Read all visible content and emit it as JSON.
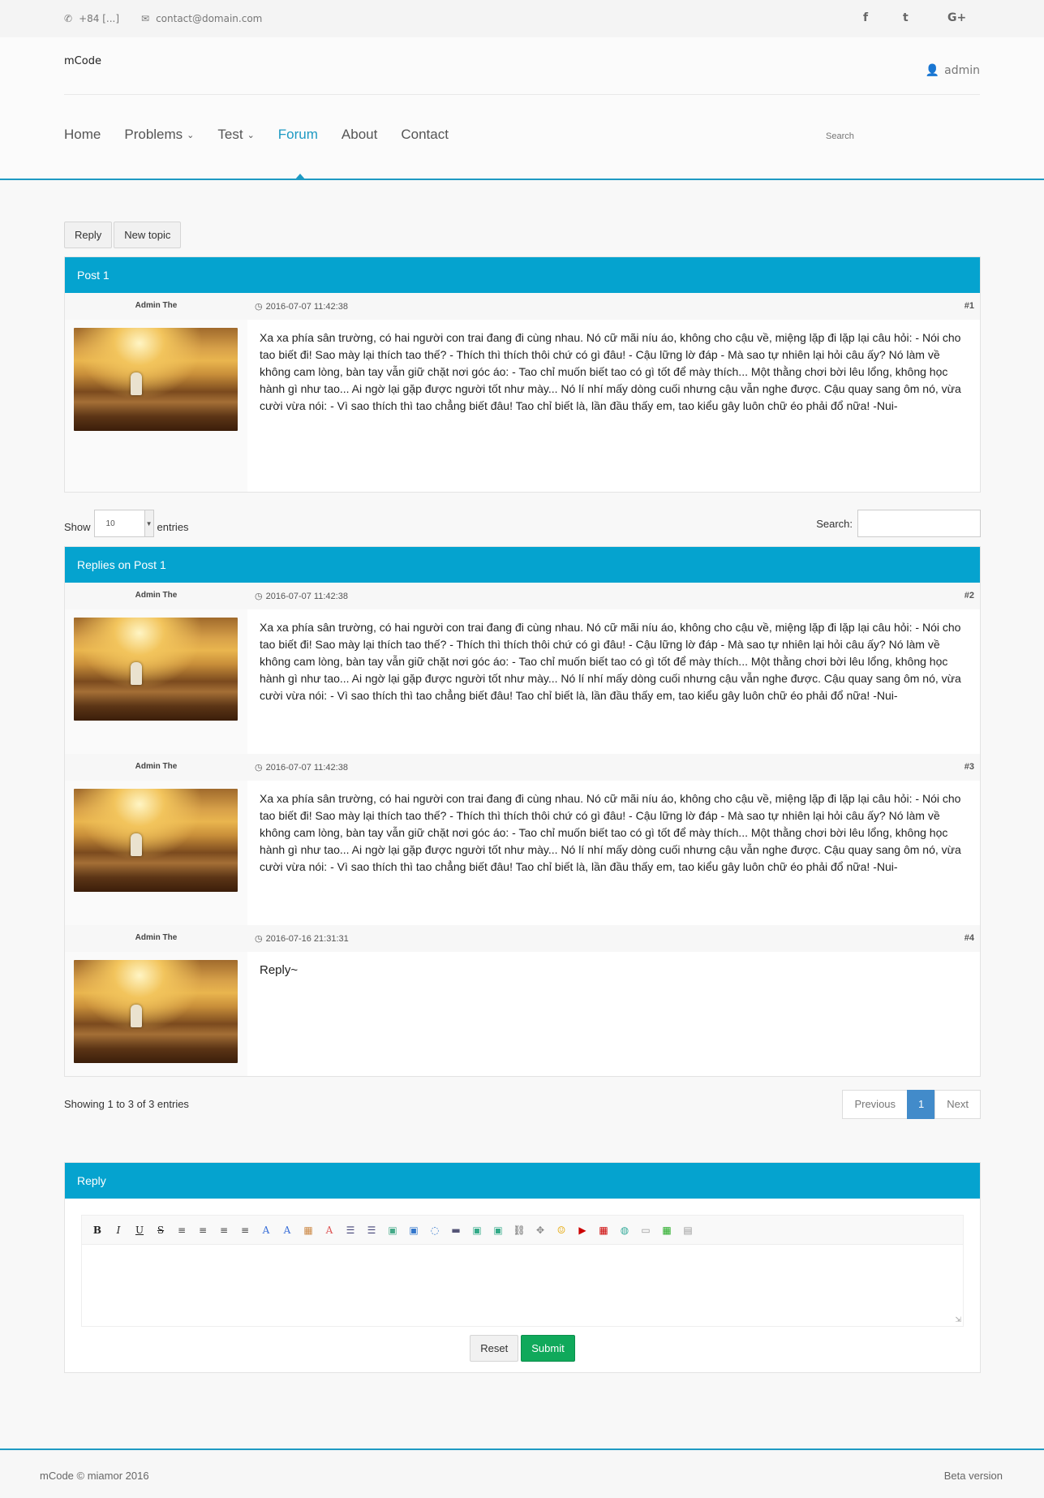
{
  "topbar": {
    "phone": "+84 [...]",
    "email": "contact@domain.com",
    "social": [
      "f",
      "t",
      "G+"
    ]
  },
  "header": {
    "logo": "mCode",
    "user": "admin",
    "nav": [
      "Home",
      "Problems",
      "Test",
      "Forum",
      "About",
      "Contact"
    ],
    "active_nav": "Forum",
    "search_placeholder": "Search"
  },
  "actions": {
    "reply": "Reply",
    "new_topic": "New topic"
  },
  "post": {
    "title": "Post 1",
    "author": "Admin The",
    "date": "2016-07-07 11:42:38",
    "number": "#1",
    "content": "Xa xa phía sân trường, có hai người con trai đang đi cùng nhau. Nó cữ mãi níu áo, không cho cậu về, miệng lặp đi lặp lại câu hỏi: - Nói cho tao biết đi! Sao mày lại thích tao thế? - Thích thì thích thôi chứ có gì đâu! - Cậu lững lờ đáp - Mà sao tự nhiên lại hỏi câu ấy? Nó làm về không cam lòng, bàn tay vẫn giữ chặt nơi góc áo: - Tao chỉ muốn biết tao có gì tốt để mày thích... Một thằng chơi bời lêu lổng, không học hành gì như tao... Ai ngờ lại gặp được người tốt như mày... Nó lí nhí mấy dòng cuối nhưng cậu vẫn nghe được. Cậu quay sang ôm nó, vừa cười vừa nói: - Vì sao thích thì tao chẳng biết đâu! Tao chỉ biết là, lần đầu thấy em, tao kiểu gây luôn chữ éo phải đổ nữa! -Nui-"
  },
  "datatable": {
    "show_label": "Show",
    "length": "10",
    "entries_label": "entries",
    "search_label": "Search:",
    "info": "Showing 1 to 3 of 3 entries",
    "prev": "Previous",
    "page": "1",
    "next": "Next"
  },
  "replies": {
    "title": "Replies on Post 1",
    "items": [
      {
        "author": "Admin The",
        "date": "2016-07-07 11:42:38",
        "number": "#2",
        "content": "Xa xa phía sân trường, có hai người con trai đang đi cùng nhau. Nó cữ mãi níu áo, không cho cậu về, miệng lặp đi lặp lại câu hỏi: - Nói cho tao biết đi! Sao mày lại thích tao thế? - Thích thì thích thôi chứ có gì đâu! - Cậu lững lờ đáp - Mà sao tự nhiên lại hỏi câu ấy? Nó làm về không cam lòng, bàn tay vẫn giữ chặt nơi góc áo: - Tao chỉ muốn biết tao có gì tốt để mày thích... Một thằng chơi bời lêu lổng, không học hành gì như tao... Ai ngờ lại gặp được người tốt như mày... Nó lí nhí mấy dòng cuối nhưng cậu vẫn nghe được. Cậu quay sang ôm nó, vừa cười vừa nói: - Vì sao thích thì tao chẳng biết đâu! Tao chỉ biết là, lần đầu thấy em, tao kiểu gây luôn chữ éo phải đổ nữa! -Nui-"
      },
      {
        "author": "Admin The",
        "date": "2016-07-07 11:42:38",
        "number": "#3",
        "content": "Xa xa phía sân trường, có hai người con trai đang đi cùng nhau. Nó cữ mãi níu áo, không cho cậu về, miệng lặp đi lặp lại câu hỏi: - Nói cho tao biết đi! Sao mày lại thích tao thế? - Thích thì thích thôi chứ có gì đâu! - Cậu lững lờ đáp - Mà sao tự nhiên lại hỏi câu ấy? Nó làm về không cam lòng, bàn tay vẫn giữ chặt nơi góc áo: - Tao chỉ muốn biết tao có gì tốt để mày thích... Một thằng chơi bời lêu lổng, không học hành gì như tao... Ai ngờ lại gặp được người tốt như mày... Nó lí nhí mấy dòng cuối nhưng cậu vẫn nghe được. Cậu quay sang ôm nó, vừa cười vừa nói: - Vì sao thích thì tao chẳng biết đâu! Tao chỉ biết là, lần đầu thấy em, tao kiểu gây luôn chữ éo phải đổ nữa! -Nui-"
      },
      {
        "author": "Admin The",
        "date": "2016-07-16 21:31:31",
        "number": "#4",
        "content": "Reply~"
      }
    ]
  },
  "reply_form": {
    "title": "Reply",
    "toolbar": [
      "B",
      "I",
      "U",
      "S",
      "≡",
      "≡",
      "≡",
      "≡",
      "A",
      "A",
      "▦",
      "A",
      "☰",
      "☰",
      "▣",
      "▣",
      "◌",
      "▬",
      "▣",
      "▣",
      "⛓",
      "✥",
      "☺",
      "▶",
      "▦",
      "◍",
      "▭",
      "▦",
      "▤"
    ],
    "reset": "Reset",
    "submit": "Submit"
  },
  "footer": {
    "copyright": "mCode © miamor 2016",
    "version": "Beta version"
  },
  "colors": {
    "accent": "#05a3cf",
    "nav_active": "#1e9ac3",
    "submit": "#10a95b",
    "page_current": "#428bca"
  }
}
